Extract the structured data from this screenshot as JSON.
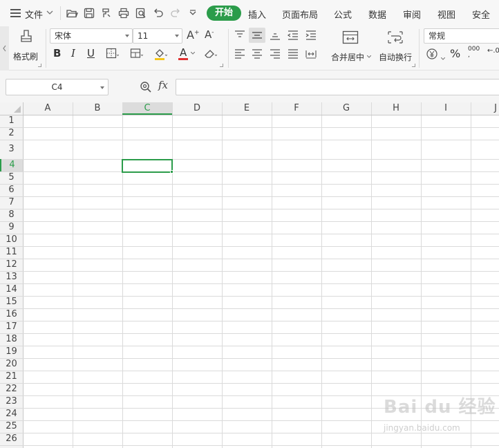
{
  "menu": {
    "file_label": "文件",
    "tabs": [
      {
        "label": "开始",
        "active": true
      },
      {
        "label": "插入"
      },
      {
        "label": "页面布局"
      },
      {
        "label": "公式"
      },
      {
        "label": "数据"
      },
      {
        "label": "审阅"
      },
      {
        "label": "视图"
      },
      {
        "label": "安全"
      }
    ],
    "accent_color": "#2b9c4a"
  },
  "ribbon": {
    "format_painter_label": "格式刷",
    "font_name": "宋体",
    "font_size": "11",
    "bold_label": "B",
    "italic_label": "I",
    "underline_label": "U",
    "grow_font_label": "A",
    "shrink_font_label": "A",
    "font_color_label": "A",
    "merge_center_label": "合并居中",
    "wrap_text_label": "自动换行",
    "number_format": "常规",
    "percent_label": "%",
    "thousands_label": "000"
  },
  "formula_bar": {
    "cell_ref": "C4",
    "fx_label": "fx",
    "formula": ""
  },
  "sheet": {
    "columns": [
      "A",
      "B",
      "C",
      "D",
      "E",
      "F",
      "G",
      "H",
      "I",
      "J"
    ],
    "rows": [
      "1",
      "2",
      "3",
      "4",
      "5",
      "6",
      "7",
      "8",
      "9",
      "10",
      "11",
      "12",
      "13",
      "14",
      "15",
      "16",
      "17",
      "18",
      "19",
      "20",
      "21",
      "22",
      "23",
      "24",
      "25",
      "26"
    ],
    "selected_column": "C",
    "selected_row": "4"
  },
  "watermark": {
    "logo_text": "Bai du 经验",
    "url_text": "jingyan.baidu.com"
  }
}
